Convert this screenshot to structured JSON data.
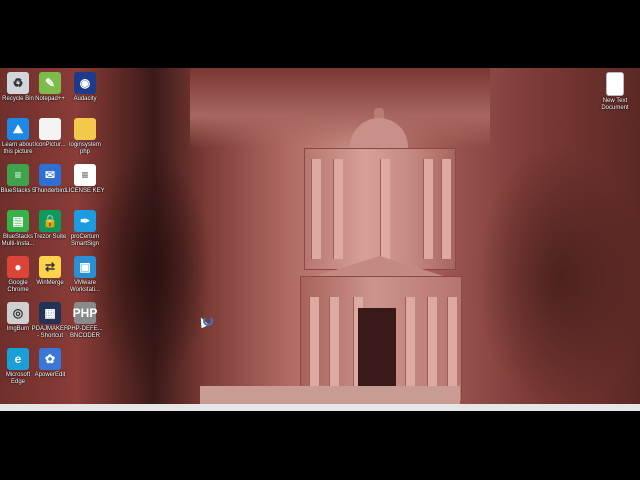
{
  "desktop_icons": [
    {
      "label": "Recycle Bin",
      "icon": "recycle-bin-icon",
      "color": "#d0d6dc",
      "glyph": "♻"
    },
    {
      "label": "Notepad++",
      "icon": "notepad-plus-plus-icon",
      "color": "#7dbb4a",
      "glyph": "✎"
    },
    {
      "label": "Audacity",
      "icon": "audacity-icon",
      "color": "#1e3a8a",
      "glyph": "◉"
    },
    {
      "label": "Learn about\nthis picture",
      "icon": "learn-about-picture-icon",
      "color": "#1e88e5",
      "glyph": "⛰"
    },
    {
      "label": "IconPictur...",
      "icon": "picture-file-icon",
      "color": "#f4f4f4",
      "glyph": ""
    },
    {
      "label": "loginsystem\nphp",
      "icon": "folder-icon",
      "color": "#f2c94c",
      "glyph": ""
    },
    {
      "label": "BlueStacks 5",
      "icon": "bluestacks-icon",
      "color": "#3fa34d",
      "glyph": "≡"
    },
    {
      "label": "Thunderbird",
      "icon": "thunderbird-icon",
      "color": "#2f6fd1",
      "glyph": "✉"
    },
    {
      "label": "LICENSE KEY",
      "icon": "text-document-icon",
      "color": "#ffffff",
      "glyph": "≡"
    },
    {
      "label": "BlueStacks\nMulti-Insta...",
      "icon": "bluestacks-multi-icon",
      "color": "#35b34a",
      "glyph": "▤"
    },
    {
      "label": "Trezor Suite",
      "icon": "trezor-icon",
      "color": "#0c9b5a",
      "glyph": "🔒"
    },
    {
      "label": "proCertum\nSmartSign",
      "icon": "procertum-icon",
      "color": "#1d9be0",
      "glyph": "✒"
    },
    {
      "label": "Google\nChrome",
      "icon": "chrome-icon",
      "color": "#db4437",
      "glyph": "●"
    },
    {
      "label": "WinMerge",
      "icon": "winmerge-icon",
      "color": "#ffd34e",
      "glyph": "⇄"
    },
    {
      "label": "VMware\nWorkstati...",
      "icon": "vmware-icon",
      "color": "#2a8fd3",
      "glyph": "▣"
    },
    {
      "label": "ImgBurn",
      "icon": "imgburn-icon",
      "color": "#cfcfcf",
      "glyph": "◎"
    },
    {
      "label": "PDAJMAKER\n- Shortcut",
      "icon": "pdajmaker-icon",
      "color": "#223355",
      "glyph": "▦"
    },
    {
      "label": "PHP-DEFE...\nBNCODER",
      "icon": "php-encoder-icon",
      "color": "#8a8a8a",
      "glyph": "PHP"
    },
    {
      "label": "Microsoft\nEdge",
      "icon": "edge-icon",
      "color": "#1a9fd6",
      "glyph": "e"
    },
    {
      "label": "ApowerEdit",
      "icon": "apoweredit-icon",
      "color": "#3a78d8",
      "glyph": "✿"
    }
  ],
  "right_icons": [
    {
      "label": "New Text\nDocument",
      "icon": "text-document-icon",
      "color": "#ffffff",
      "glyph": ""
    }
  ]
}
